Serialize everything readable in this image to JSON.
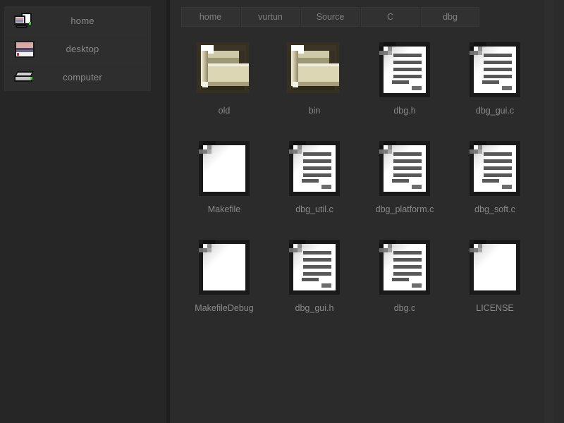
{
  "sidebar": {
    "items": [
      {
        "label": "home",
        "icon": "computer-monitor-icon"
      },
      {
        "label": "desktop",
        "icon": "desktop-wallpaper-icon"
      },
      {
        "label": "computer",
        "icon": "hard-drive-icon"
      }
    ]
  },
  "breadcrumb": {
    "items": [
      {
        "label": "home"
      },
      {
        "label": "vurtun"
      },
      {
        "label": "Source"
      },
      {
        "label": "C"
      },
      {
        "label": "dbg"
      }
    ]
  },
  "files": {
    "items": [
      {
        "name": "old",
        "type": "folder"
      },
      {
        "name": "bin",
        "type": "folder"
      },
      {
        "name": "dbg.h",
        "type": "text-file"
      },
      {
        "name": "dbg_gui.c",
        "type": "text-file"
      },
      {
        "name": "Makefile",
        "type": "blank-file"
      },
      {
        "name": "dbg_util.c",
        "type": "text-file"
      },
      {
        "name": "dbg_platform.c",
        "type": "text-file"
      },
      {
        "name": "dbg_soft.c",
        "type": "text-file"
      },
      {
        "name": "MakefileDebug",
        "type": "blank-file"
      },
      {
        "name": "dbg_gui.h",
        "type": "text-file"
      },
      {
        "name": "dbg.c",
        "type": "text-file"
      },
      {
        "name": "LICENSE",
        "type": "blank-file"
      }
    ]
  },
  "colors": {
    "window_background": "#2b2b2b",
    "sidebar_background": "#262626",
    "panel_background": "#2e2e2e",
    "panel_border": "#383838",
    "splitter": "#1e1e1e",
    "text": "#8a8a8a",
    "folder_fill": "#ddd6b4",
    "folder_border": "#35301f",
    "document_fill": "#ffffff",
    "document_border": "#1a1a1a",
    "led_green": "#49d13c"
  }
}
